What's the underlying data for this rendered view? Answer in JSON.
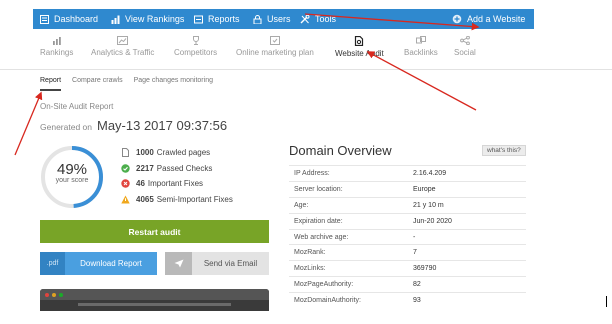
{
  "topnav": {
    "items": [
      {
        "label": "Dashboard",
        "icon": "dashboard-icon"
      },
      {
        "label": "View Rankings",
        "icon": "bar-chart-icon"
      },
      {
        "label": "Reports",
        "icon": "report-icon"
      },
      {
        "label": "Users",
        "icon": "lock-icon"
      },
      {
        "label": "Tools",
        "icon": "tools-icon"
      }
    ],
    "add_website": "Add a Website",
    "bar_color": "#2f89cf"
  },
  "subnav": {
    "items": [
      {
        "label": "Rankings",
        "icon": "rankings-icon"
      },
      {
        "label": "Analytics & Traffic",
        "icon": "analytics-icon"
      },
      {
        "label": "Competitors",
        "icon": "trophy-icon"
      },
      {
        "label": "Online marketing plan",
        "icon": "checklist-icon"
      },
      {
        "label": "Website Audit",
        "icon": "audit-icon",
        "active": true
      },
      {
        "label": "Backlinks",
        "icon": "backlinks-icon"
      },
      {
        "label": "Social",
        "icon": "share-icon"
      }
    ]
  },
  "tabs": [
    "Report",
    "Compare crawls",
    "Page changes monitoring"
  ],
  "report": {
    "title": "On-Site Audit Report",
    "generated_label": "Generated on",
    "generated_date": "May-13 2017 09:37:56",
    "score_pct": "49%",
    "score_value": 0.49,
    "score_sub": "your score",
    "stats": [
      {
        "count": "1000",
        "label": "Crawled pages",
        "icon": "page-icon"
      },
      {
        "count": "2217",
        "label": "Passed Checks",
        "icon": "check-circle-icon"
      },
      {
        "count": "46",
        "label": "Important Fixes",
        "icon": "error-circle-icon"
      },
      {
        "count": "4065",
        "label": "Semi-Important Fixes",
        "icon": "warning-icon"
      }
    ]
  },
  "buttons": {
    "restart": "Restart audit",
    "pdf_ext": ".pdf",
    "download": "Download Report",
    "email": "Send via Email"
  },
  "domain": {
    "title": "Domain Overview",
    "whats_this": "what's this?",
    "rows": [
      {
        "key": "IP Address:",
        "value": "2.16.4.209"
      },
      {
        "key": "Server location:",
        "value": "Europe"
      },
      {
        "key": "Age:",
        "value": "21 y 10 m"
      },
      {
        "key": "Expiration date:",
        "value": "Jun-20 2020"
      },
      {
        "key": "Web archive age:",
        "value": "-"
      },
      {
        "key": "MozRank:",
        "value": "7"
      },
      {
        "key": "MozLinks:",
        "value": "369790"
      },
      {
        "key": "MozPageAuthority:",
        "value": "82"
      },
      {
        "key": "MozDomainAuthority:",
        "value": "93"
      }
    ]
  },
  "colors": {
    "accent": "#2f89cf",
    "green": "#78a427",
    "annotation": "#d8281f"
  }
}
